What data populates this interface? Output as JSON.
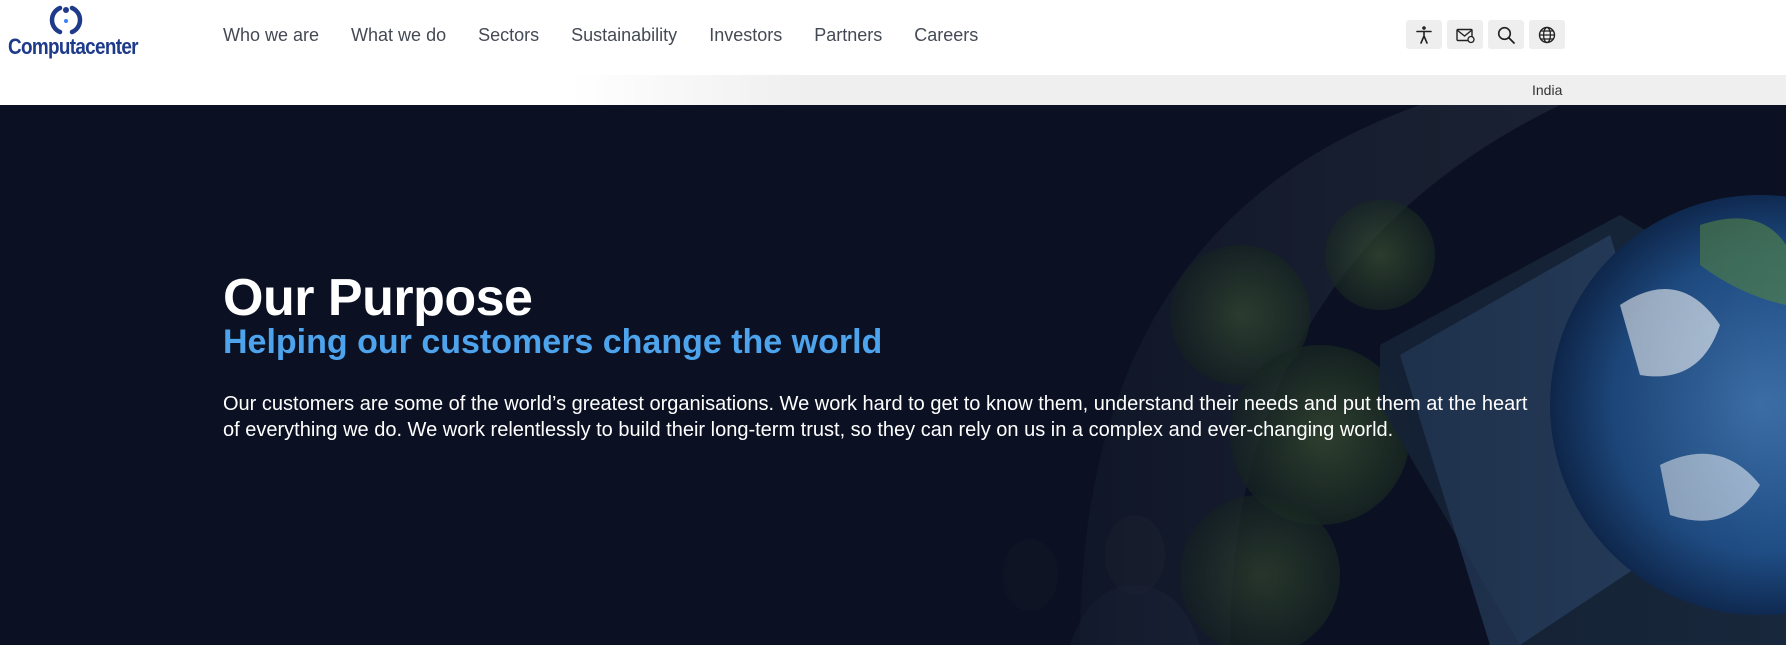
{
  "brand": {
    "name": "Computacenter",
    "logo_color": "#1e3a8a"
  },
  "nav": {
    "items": [
      {
        "label": "Who we are"
      },
      {
        "label": "What we do"
      },
      {
        "label": "Sectors"
      },
      {
        "label": "Sustainability"
      },
      {
        "label": "Investors"
      },
      {
        "label": "Partners"
      },
      {
        "label": "Careers"
      }
    ]
  },
  "tools": {
    "icons": [
      "accessibility-icon",
      "contact-mail-icon",
      "search-icon",
      "globe-icon"
    ]
  },
  "region": {
    "label": "India"
  },
  "hero": {
    "title": "Our Purpose",
    "subtitle": "Helping our customers change the world",
    "body": "Our customers are some of the world’s greatest organisations. We work hard to get to know them, understand their needs and put them at the heart of everything we do. We work relentlessly to build their long-term trust, so they can rely on us in a complex and ever-changing world.",
    "colors": {
      "background": "#0b1122",
      "subtitle": "#4da3ec",
      "text": "#ffffff"
    }
  }
}
